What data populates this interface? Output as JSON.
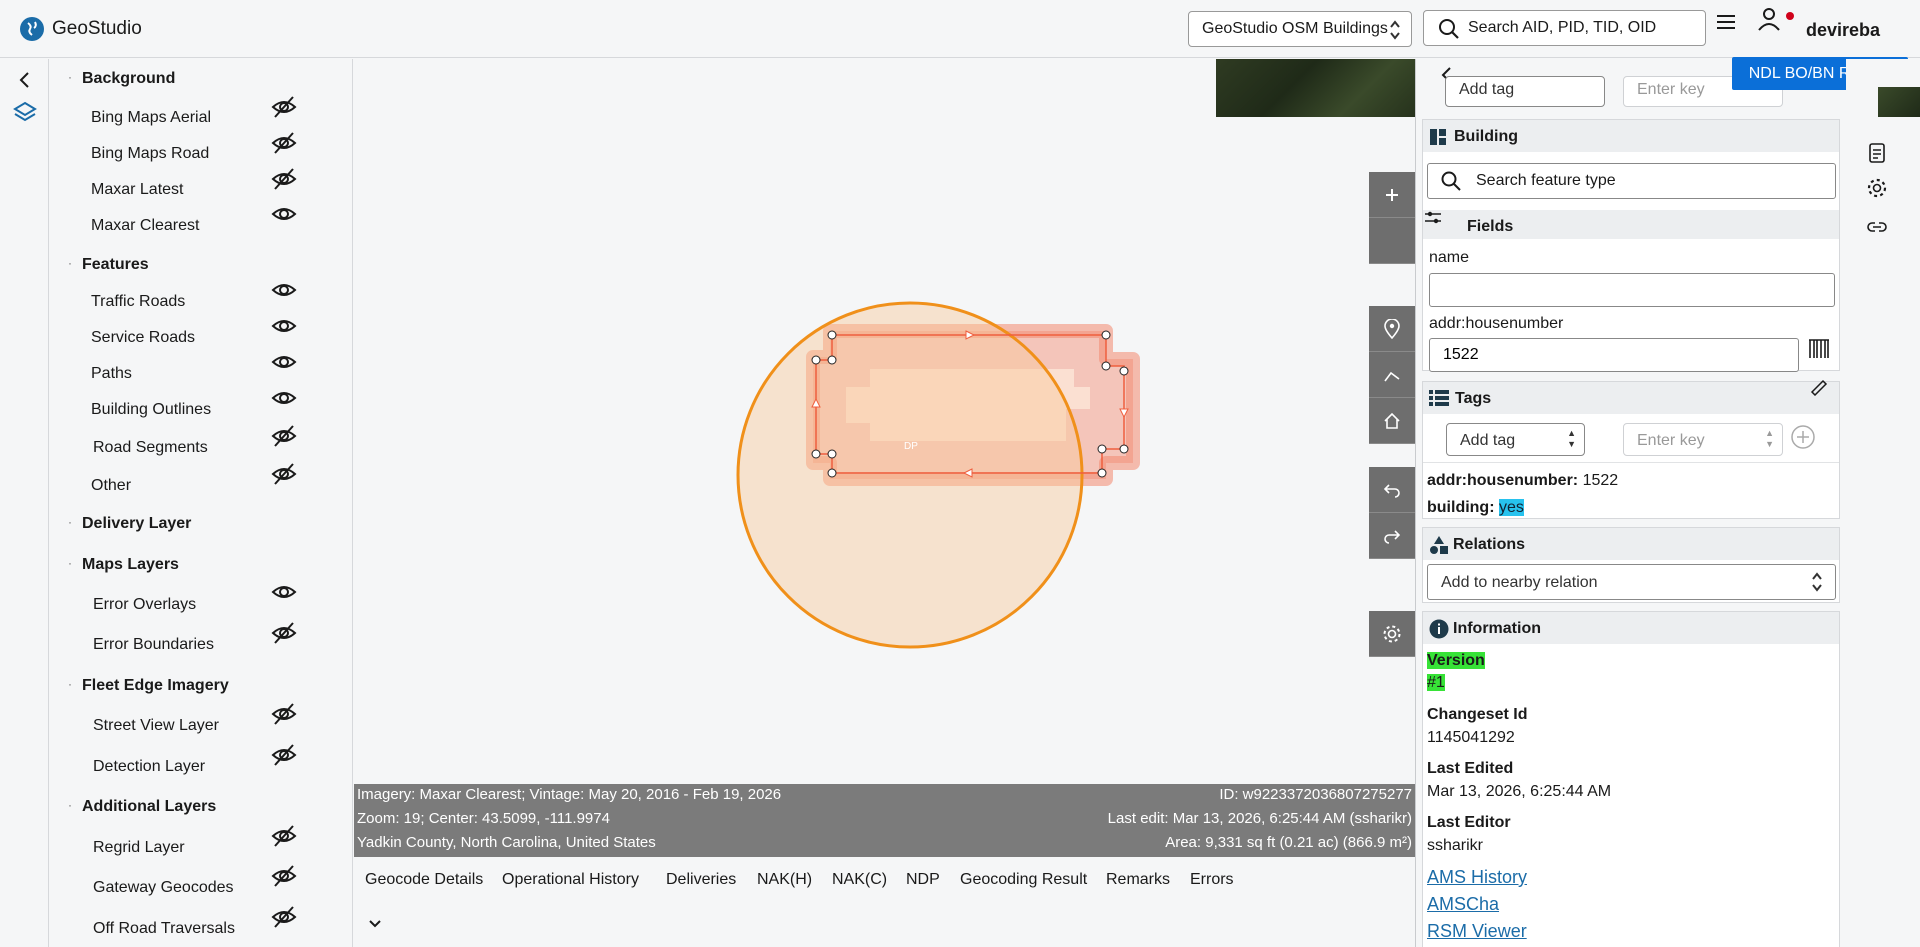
{
  "app": {
    "title": "GeoStudio"
  },
  "header": {
    "dataset": "GeoStudio OSM Buildings",
    "search_placeholder": "Search AID, PID, TID, OID",
    "username": "devireba"
  },
  "layers": {
    "sections": [
      {
        "label": "Background",
        "items": [
          {
            "label": "Bing Maps Aerial",
            "visible": false
          },
          {
            "label": "Bing Maps Road",
            "visible": false
          },
          {
            "label": "Maxar Latest",
            "visible": false
          },
          {
            "label": "Maxar Clearest",
            "visible": true
          }
        ]
      },
      {
        "label": "Features",
        "items": [
          {
            "label": "Traffic Roads",
            "visible": true
          },
          {
            "label": "Service Roads",
            "visible": true
          },
          {
            "label": "Paths",
            "visible": true
          },
          {
            "label": "Building Outlines",
            "visible": true
          },
          {
            "label": "Road Segments",
            "visible": false
          },
          {
            "label": "Other",
            "visible": false
          }
        ]
      },
      {
        "label": "Delivery Layer",
        "items": []
      },
      {
        "label": "Maps Layers",
        "items": [
          {
            "label": "Error Overlays",
            "visible": true
          },
          {
            "label": "Error Boundaries",
            "visible": false
          }
        ]
      },
      {
        "label": "Fleet Edge Imagery",
        "items": [
          {
            "label": "Street View Layer",
            "visible": false
          },
          {
            "label": "Detection Layer",
            "visible": false
          }
        ]
      },
      {
        "label": "Additional Layers",
        "items": [
          {
            "label": "Regrid Layer",
            "visible": false
          },
          {
            "label": "Gateway Geocodes",
            "visible": false
          },
          {
            "label": "Off Road Traversals",
            "visible": false
          }
        ]
      }
    ]
  },
  "map": {
    "dp_label": "DP",
    "info": {
      "imagery": "Imagery: Maxar Clearest; Vintage: May 20, 2016 - Feb 19, 2026",
      "zoom": "Zoom: 19; Center: 43.5099, -111.9974",
      "location": "Yadkin County, North Carolina, United States",
      "id": "ID: w9223372036807275277",
      "last_edit": "Last edit: Mar 13, 2026, 6:25:44 AM (ssharikr)",
      "area": "Area: 9,331 sq ft (0.21 ac) (866.9 m²)"
    }
  },
  "bottom_tabs": [
    "Geocode Details",
    "Operational History",
    "Deliveries",
    "NAK(H)",
    "NAK(C)",
    "NDP",
    "Geocoding Result",
    "Remarks",
    "Errors"
  ],
  "review_button": "NDL BO/BN Review",
  "editor": {
    "top_tag_placeholder": "Add tag",
    "top_key_placeholder": "Enter key",
    "feature_type": "Building",
    "feature_search_placeholder": "Search feature type",
    "fields_title": "Fields",
    "name_label": "name",
    "name_value": "",
    "housenumber_label": "addr:housenumber",
    "housenumber_value": "1522",
    "tags_title": "Tags",
    "tag_placeholder": "Add tag",
    "key_placeholder": "Enter key",
    "tags": [
      {
        "key": "addr:housenumber:",
        "value": "1522"
      },
      {
        "key": "building:",
        "value": "yes"
      }
    ],
    "relations_title": "Relations",
    "relations_placeholder": "Add to nearby relation",
    "information_title": "Information",
    "version_label": "Version",
    "version_value": "#1",
    "changeset_label": "Changeset Id",
    "changeset_value": "1145041292",
    "last_edited_label": "Last Edited",
    "last_edited_value": "Mar 13, 2026, 6:25:44 AM",
    "last_editor_label": "Last Editor",
    "last_editor_value": "ssharikr",
    "links": [
      "AMS History",
      "AMSCha",
      "RSM Viewer"
    ]
  },
  "colors": {
    "accent": "#1b6ca8",
    "review_button": "#0b6fd8",
    "selection_circle": "#f0901a",
    "building_fill": "#f3896f",
    "highlight_value": "#27c2ee",
    "highlight_version": "#37e237"
  }
}
